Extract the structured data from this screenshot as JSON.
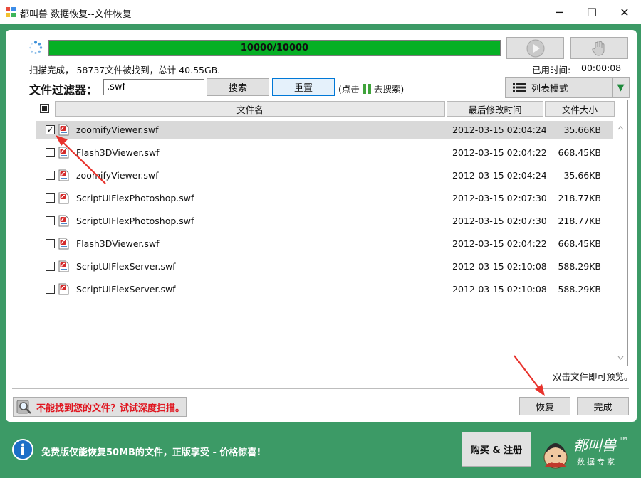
{
  "window": {
    "title": "都叫兽 数据恢复--文件恢复",
    "minimize_glyph": "─",
    "maximize_glyph": "☐",
    "close_glyph": "✕"
  },
  "scan": {
    "progress_text": "10000/10000",
    "progress": 1.0,
    "status_text": "扫描完成， 58737文件被找到，总计 40.55GB.",
    "elapsed_label": "已用时间:",
    "elapsed_value": "00:00:08"
  },
  "filter": {
    "label": "文件过滤器：",
    "value": ".swf",
    "search_label": "搜索",
    "reset_label": "重置",
    "hint_prefix": "(点击",
    "hint_suffix": "去搜索)"
  },
  "view_mode": {
    "label": "列表模式"
  },
  "table": {
    "columns": [
      "文件名",
      "最后修改时间",
      "文件大小"
    ],
    "rows": [
      {
        "name": "zoomifyViewer.swf",
        "modified": "2012-03-15 02:04:24",
        "size": "35.66KB",
        "checked": true,
        "selected": true
      },
      {
        "name": "Flash3DViewer.swf",
        "modified": "2012-03-15 02:04:22",
        "size": "668.45KB",
        "checked": false,
        "selected": false
      },
      {
        "name": "zoomifyViewer.swf",
        "modified": "2012-03-15 02:04:24",
        "size": "35.66KB",
        "checked": false,
        "selected": false
      },
      {
        "name": "ScriptUIFlexPhotoshop.swf",
        "modified": "2012-03-15 02:07:30",
        "size": "218.77KB",
        "checked": false,
        "selected": false
      },
      {
        "name": "ScriptUIFlexPhotoshop.swf",
        "modified": "2012-03-15 02:07:30",
        "size": "218.77KB",
        "checked": false,
        "selected": false
      },
      {
        "name": "Flash3DViewer.swf",
        "modified": "2012-03-15 02:04:22",
        "size": "668.45KB",
        "checked": false,
        "selected": false
      },
      {
        "name": "ScriptUIFlexServer.swf",
        "modified": "2012-03-15 02:10:08",
        "size": "588.29KB",
        "checked": false,
        "selected": false
      },
      {
        "name": "ScriptUIFlexServer.swf",
        "modified": "2012-03-15 02:10:08",
        "size": "588.29KB",
        "checked": false,
        "selected": false
      }
    ]
  },
  "preview_hint": "双击文件即可预览。",
  "actions": {
    "deep_scan_label": "不能找到您的文件？试试深度扫描。",
    "recover_label": "恢复",
    "finish_label": "完成"
  },
  "footer": {
    "notice": "免费版仅能恢复50MB的文件，正版享受 - 价格惊喜!",
    "buy_label": "购买 & 注册",
    "logo_text": "都叫兽",
    "logo_subtext": "数据专家",
    "logo_tm": "TM"
  },
  "colors": {
    "progress_fill": "#06b025",
    "frame_green": "#3c9a66",
    "deep_scan_text": "#e0141e",
    "annotation_arrow": "#e8322c"
  }
}
